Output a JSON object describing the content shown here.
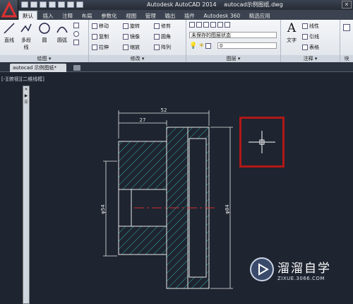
{
  "window": {
    "app_title": "Autodesk AutoCAD 2014",
    "file_title": "autocad示例图纸.dwg",
    "close_label": "✕"
  },
  "tabs": [
    "默认",
    "插入",
    "注释",
    "布局",
    "参数化",
    "视图",
    "管理",
    "输出",
    "插件",
    "Autodesk 360",
    "精选应用"
  ],
  "ribbon": {
    "draw": {
      "title": "绘图 ▾",
      "line": "直线",
      "polyline": "多段线",
      "circle": "圆",
      "arc": "圆弧"
    },
    "modify": {
      "title": "修改 ▾",
      "move": "移动",
      "rotate": "旋转",
      "trim": "修剪",
      "copy": "复制",
      "mirror": "镜像",
      "fillet": "圆角",
      "stretch": "拉伸",
      "scale": "缩放",
      "array": "阵列"
    },
    "layers": {
      "title": "图层 ▾",
      "state": "未保存的图层状态",
      "current": "0"
    },
    "annotation": {
      "title": "注释 ▾",
      "text": "文字",
      "linear": "线性",
      "leader": "引线",
      "table": "表格"
    },
    "block": {
      "title": "块"
    }
  },
  "doc_tab": "autocad 示例图纸*",
  "viewport_label": "[-][俯视][二维线框]",
  "palette_glyphs": [
    "✕",
    "▶",
    "☰"
  ],
  "dimensions": {
    "overall_width": "52",
    "partial_width": "27",
    "diameter_left": "φ54",
    "diameter_right": "φ84"
  },
  "watermark": {
    "main": "溜溜自学",
    "sub": "ZIXUE.3066.COM"
  },
  "colors": {
    "canvas": "#1e2430",
    "hatch": "#2fb3a8",
    "dimension": "#e8e8e8",
    "centerline": "#d03030",
    "highlight": "#b01818"
  }
}
